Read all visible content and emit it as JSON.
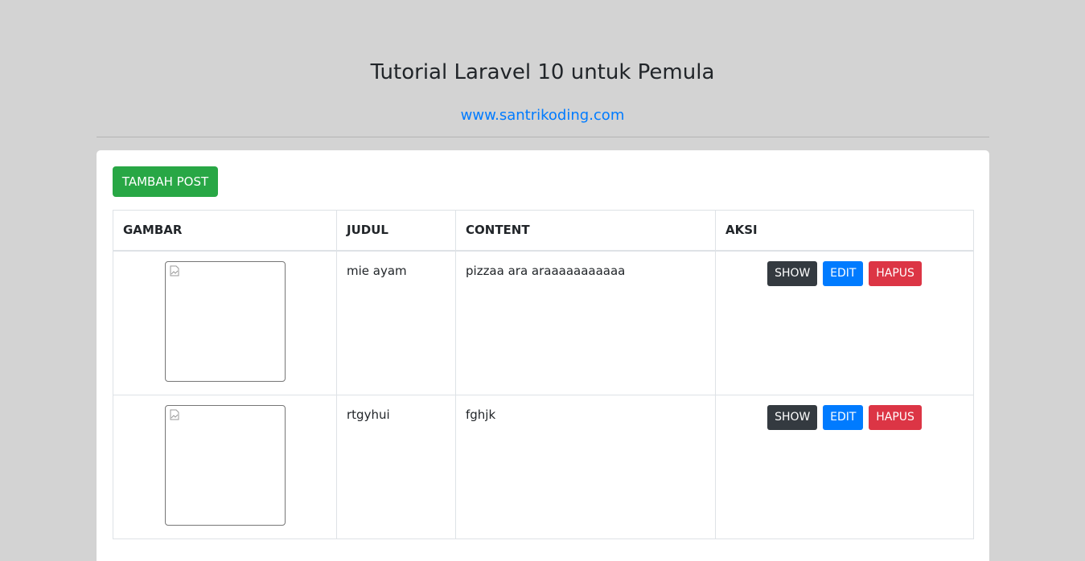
{
  "header": {
    "title": "Tutorial Laravel 10 untuk Pemula",
    "link": "www.santrikoding.com"
  },
  "toolbar": {
    "add_label": "TAMBAH POST"
  },
  "table": {
    "columns": [
      "GAMBAR",
      "JUDUL",
      "CONTENT",
      "AKSI"
    ],
    "rows": [
      {
        "judul": "mie ayam",
        "content": "pizzaa ara araaaaaaaaaaa"
      },
      {
        "judul": "rtgyhui",
        "content": "fghjk"
      }
    ],
    "actions": {
      "show": "SHOW",
      "edit": "EDIT",
      "delete": "HAPUS"
    }
  },
  "colors": {
    "background": "#d3d3d3",
    "link": "#007bff",
    "add": "#28a745",
    "show": "#343a40",
    "edit": "#007bff",
    "delete": "#dc3545"
  }
}
